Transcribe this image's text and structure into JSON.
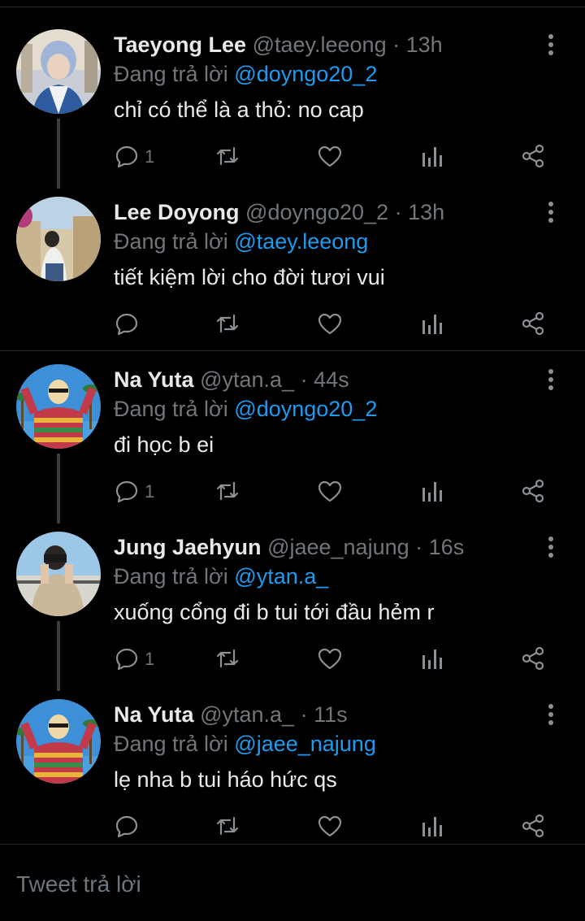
{
  "tweets": [
    {
      "name": "Taeyong Lee",
      "handle": "@taey.leeong",
      "dot": "·",
      "time": "13h",
      "reply_prefix": "Đang trả lời",
      "mention": "@doyngo20_2",
      "text": "chỉ có thể là a thỏ: no cap",
      "reply_count": "1"
    },
    {
      "name": "Lee Doyong",
      "handle": "@doyngo20_2",
      "dot": "·",
      "time": "13h",
      "reply_prefix": "Đang trả lời",
      "mention": "@taey.leeong",
      "text": "tiết kiệm lời cho đời tươi vui",
      "reply_count": ""
    },
    {
      "name": "Na Yuta",
      "handle": "@ytan.a_",
      "dot": "·",
      "time": "44s",
      "reply_prefix": "Đang trả lời",
      "mention": "@doyngo20_2",
      "text": "đi học b ei",
      "reply_count": "1"
    },
    {
      "name": "Jung Jaehyun",
      "handle": "@jaee_najung",
      "dot": "·",
      "time": "16s",
      "reply_prefix": "Đang trả lời",
      "mention": "@ytan.a_",
      "text": "xuống cổng đi b tui tới đầu hẻm r",
      "reply_count": "1"
    },
    {
      "name": "Na Yuta",
      "handle": "@ytan.a_",
      "dot": "·",
      "time": "11s",
      "reply_prefix": "Đang trả lời",
      "mention": "@jaee_najung",
      "text": "lẹ nha b tui háo hức qs",
      "reply_count": ""
    }
  ],
  "icons": {
    "reply": "reply-icon",
    "retweet": "retweet-icon",
    "like": "heart-icon",
    "analytics": "analytics-icon",
    "share": "share-icon",
    "more": "more-vertical-icon"
  },
  "colors": {
    "background": "#000000",
    "accent": "#1d9bf0",
    "muted": "#71767b",
    "text": "#e7e9ea"
  },
  "composer": {
    "placeholder": "Tweet trả lời"
  }
}
